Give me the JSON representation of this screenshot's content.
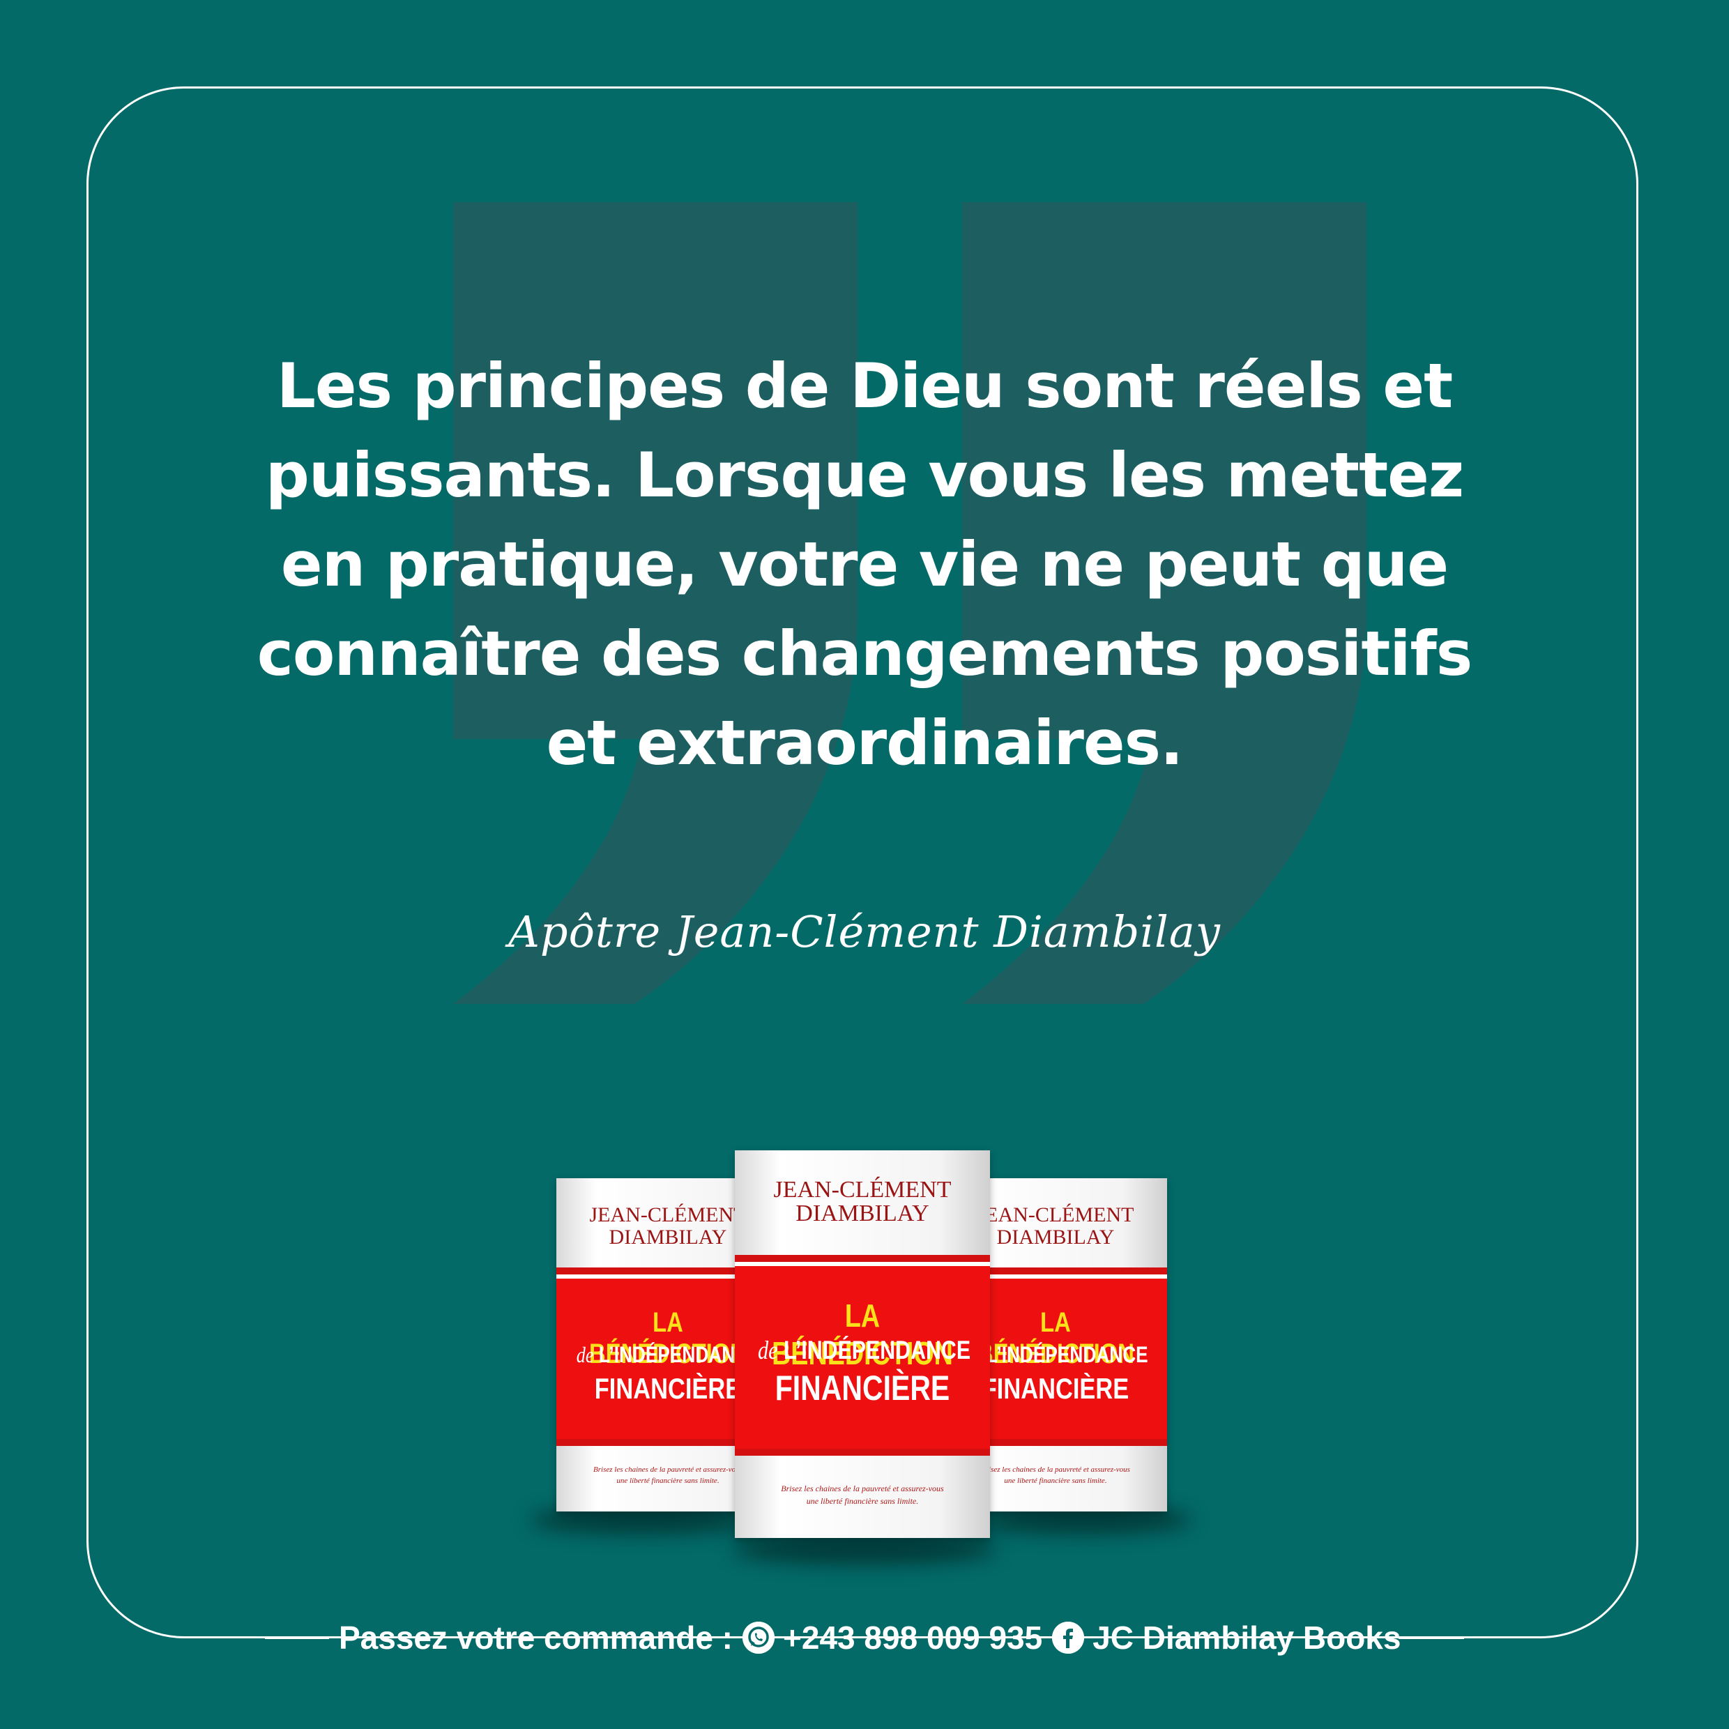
{
  "colors": {
    "background": "#036a68",
    "quote_mark": "#1d5f60",
    "text": "#ffffff",
    "book_band": "#ee1010",
    "book_title_yellow": "#f9e21a",
    "book_author": "#9a1414"
  },
  "quote": {
    "lines": [
      "Les principes de Dieu sont réels et",
      "puissants. Lorsque vous les mettez",
      "en pratique, votre vie ne peut que",
      "connaître des changements positifs",
      "et extraordinaires."
    ],
    "author": "Apôtre Jean-Clément Diambilay"
  },
  "book": {
    "author_line1": "JEAN-CLÉMENT",
    "author_line2": "DIAMBILAY",
    "title_line1": "LA BÉNÉDICTION",
    "title_de": "de",
    "title_line2": "L’INDÉPENDANCE",
    "title_line3": "FINANCIÈRE",
    "tagline_line1": "Brisez les chaines de la pauvreté et assurez-vous",
    "tagline_line2": "une liberté financière sans limite."
  },
  "footer": {
    "order_label": "Passez votre commande :",
    "whatsapp_icon": "whatsapp-icon",
    "phone": "+243 898 009 935",
    "facebook_icon": "facebook-icon",
    "page_name": "JC Diambilay Books"
  }
}
